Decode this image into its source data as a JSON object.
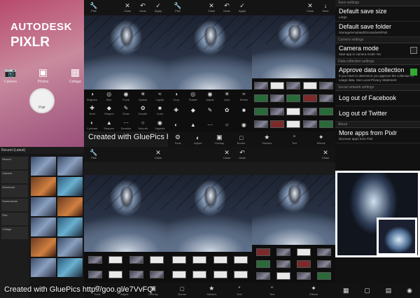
{
  "splash": {
    "brand_line1": "AUTODESK",
    "brand_line2": "PIXLR",
    "icons": [
      {
        "label": "Camera",
        "icon": "camera-icon"
      },
      {
        "label": "Photos",
        "icon": "photos-icon"
      },
      {
        "label": "Collage",
        "icon": "collage-icon"
      }
    ],
    "pixlr_label": "Pixlr"
  },
  "editor_topbar": {
    "menu_label": "Pixlr",
    "close_label": "Close",
    "undo_label": "Undo",
    "apply_label": "Apply",
    "save_label": "Save"
  },
  "tools_grid_labels": [
    "Brighten",
    "Blur",
    "Focal",
    "Splash",
    "Liquify",
    "Heal",
    "Shapes",
    "Draw",
    "Doodle",
    "Color",
    "Contrast",
    "Sharpen",
    "Denoise",
    "Smooth",
    "Vignette",
    "Crop",
    "Rotate",
    "Adjust",
    "Auto",
    "Refine"
  ],
  "bottom_tabs": [
    "Tools",
    "Adjust",
    "Overlay",
    "Border",
    "Stickers",
    "Text",
    "Effects"
  ],
  "settings": {
    "sections": [
      "Save settings",
      "Camera settings",
      "Data collection settings",
      "Social network settings",
      "About"
    ],
    "save_size_title": "Default save size",
    "save_size_value": "Large",
    "save_folder_title": "Default save folder",
    "save_folder_value": "/storage/emulated/0/Autodesk/Pixlr",
    "camera_mode_title": "Camera mode",
    "camera_mode_sub": "Start app in camera mode: No",
    "approve_title": "Approve data collection",
    "approve_sub": "If you have to determine you approve the collection of usage data. See Local Privacy Statement",
    "facebook_label": "Log out of Facebook",
    "twitter_label": "Log out of Twitter",
    "more_apps_title": "More apps from Pixlr",
    "more_apps_sub": "Discover apps from Pixlr"
  },
  "gallery": {
    "header": "Recent (Latest)",
    "folders": [
      "Recent",
      "Camera",
      "Download",
      "Screenshots",
      "Pixlr",
      "Collage"
    ]
  },
  "watermark_text": "Created with GluePics http://goo.gl/e7VvFQ"
}
